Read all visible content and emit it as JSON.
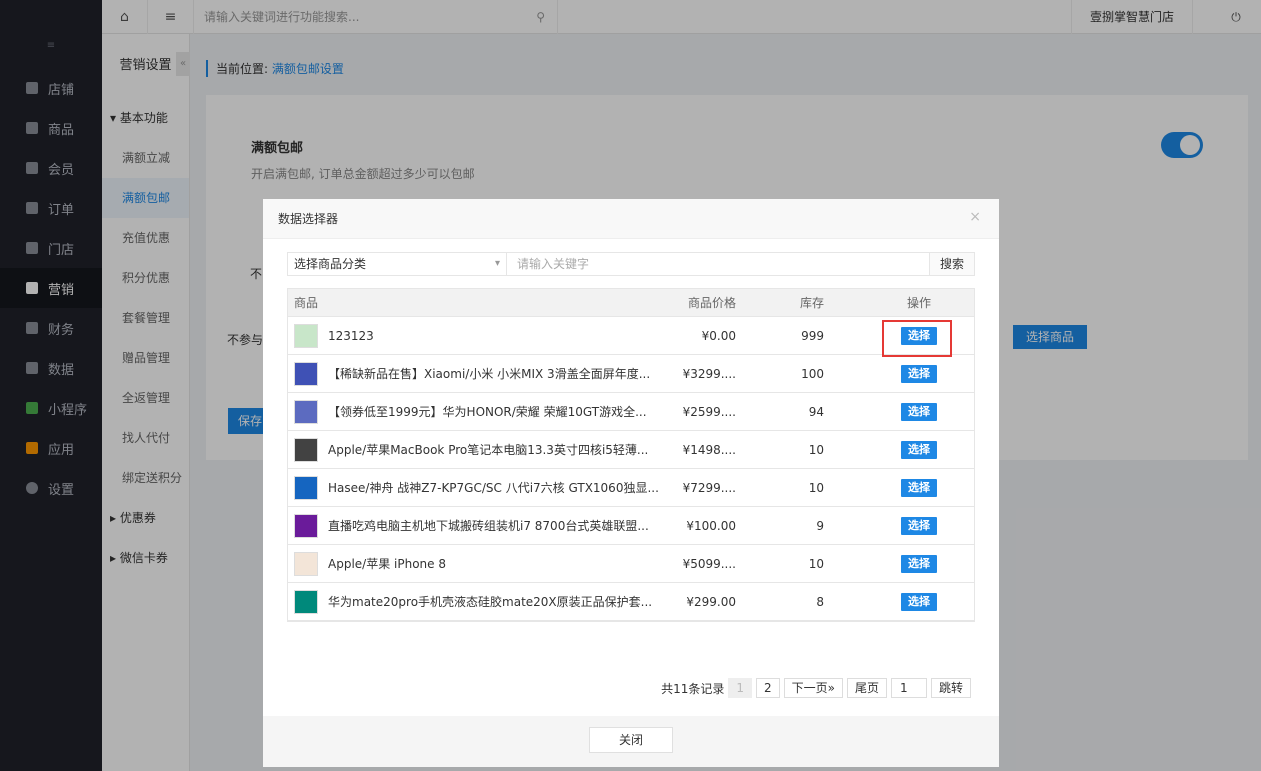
{
  "topbar": {
    "search_placeholder": "请输入关键词进行功能搜索...",
    "store_name": "壹捌掌智慧门店"
  },
  "sidebar": {
    "items": [
      {
        "label": "店铺"
      },
      {
        "label": "商品"
      },
      {
        "label": "会员"
      },
      {
        "label": "订单"
      },
      {
        "label": "门店"
      },
      {
        "label": "营销"
      },
      {
        "label": "财务"
      },
      {
        "label": "数据"
      },
      {
        "label": "小程序"
      },
      {
        "label": "应用"
      },
      {
        "label": "设置"
      }
    ]
  },
  "submenu": {
    "title": "营销设置",
    "group1": "基本功能",
    "items": [
      "满额立减",
      "满额包邮",
      "充值优惠",
      "积分优惠",
      "套餐管理",
      "赠品管理",
      "全返管理",
      "找人代付",
      "绑定送积分"
    ],
    "group2": "优惠券",
    "group3": "微信卡券"
  },
  "breadcrumb": {
    "prefix": "当前位置:",
    "current": "满额包邮设置"
  },
  "panel": {
    "title": "满额包邮",
    "desc": "开启满包邮, 订单总金额超过多少可以包邮",
    "text1": "不",
    "text2": "不参与",
    "btn": "选择商品",
    "save": "保存"
  },
  "modal": {
    "title": "数据选择器",
    "category_placeholder": "选择商品分类",
    "keyword_placeholder": "请输入关键字",
    "search_btn": "搜索",
    "headers": {
      "name": "商品",
      "price": "商品价格",
      "stock": "库存",
      "op": "操作"
    },
    "pick_label": "选择",
    "rows": [
      {
        "name": "123123",
        "price": "¥0.00",
        "stock": "999",
        "thumb": "#c8e6c9"
      },
      {
        "name": "【稀缺新品在售】Xiaomi/小米 小米MIX 3滑盖全面屏年度...",
        "price": "¥3299....",
        "stock": "100",
        "thumb": "#3f51b5"
      },
      {
        "name": "【领券低至1999元】华为HONOR/荣耀 荣耀10GT游戏全...",
        "price": "¥2599....",
        "stock": "94",
        "thumb": "#5c6bc0"
      },
      {
        "name": "Apple/苹果MacBook Pro笔记本电脑13.3英寸四核i5轻薄...",
        "price": "¥1498....",
        "stock": "10",
        "thumb": "#424242"
      },
      {
        "name": "Hasee/神舟 战神Z7-KP7GC/SC 八代i7六核 GTX1060独显...",
        "price": "¥7299....",
        "stock": "10",
        "thumb": "#1565c0"
      },
      {
        "name": "直播吃鸡电脑主机地下城搬砖组装机i7 8700台式英雄联盟...",
        "price": "¥100.00",
        "stock": "9",
        "thumb": "#6a1b9a"
      },
      {
        "name": "Apple/苹果 iPhone 8",
        "price": "¥5099....",
        "stock": "10",
        "thumb": "#f3e5d8"
      },
      {
        "name": "华为mate20pro手机壳液态硅胶mate20X原装正品保护套...",
        "price": "¥299.00",
        "stock": "8",
        "thumb": "#00897b"
      }
    ],
    "pager": {
      "total": "共11条记录",
      "p1": "1",
      "p2": "2",
      "next": "下一页»",
      "last": "尾页",
      "jump_value": "1",
      "jump": "跳转"
    },
    "close_btn": "关闭"
  }
}
